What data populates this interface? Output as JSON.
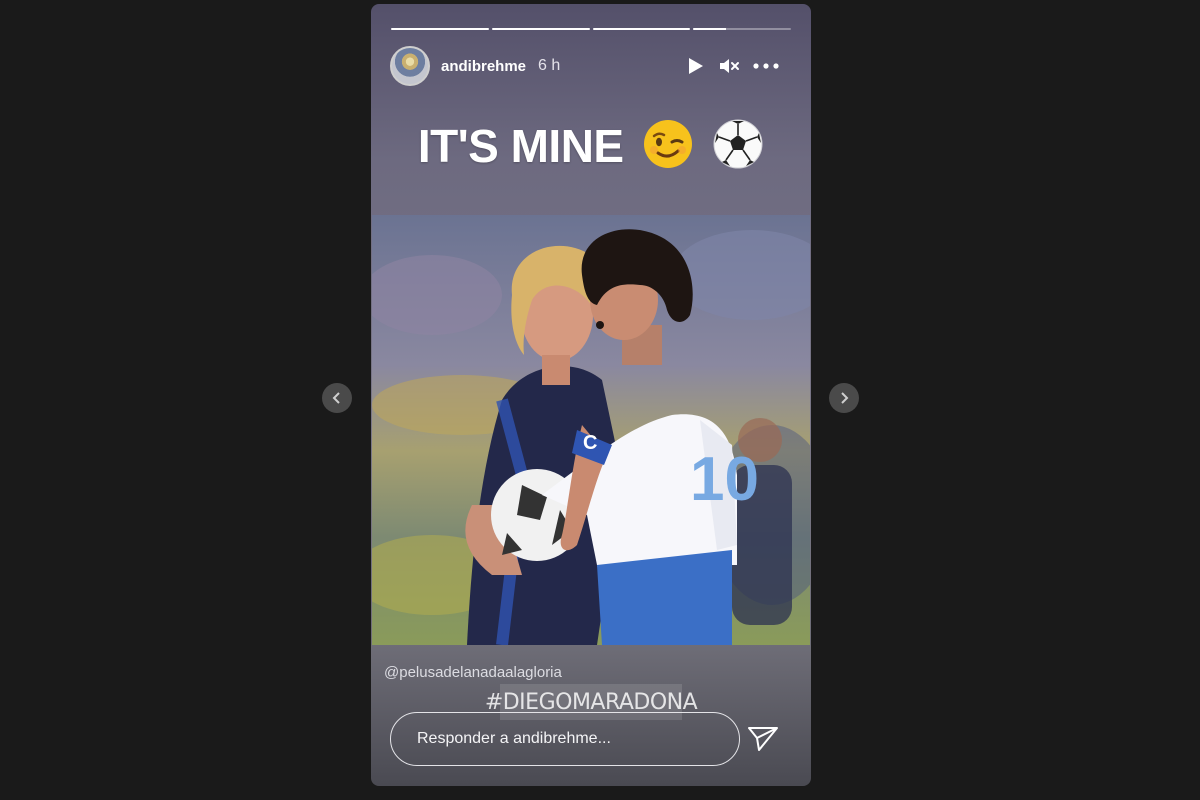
{
  "story": {
    "username": "andibrehme",
    "time_ago": "6 h",
    "progress": [
      1.0,
      1.0,
      1.0,
      0.33
    ],
    "caption_text": "IT'S MINE",
    "caption_emojis": [
      "winking-face-icon",
      "soccer-ball-icon"
    ],
    "mention": "@pelusadelanadaalagloria",
    "hashtag": "#DIEGOMARADONA",
    "photo_jersey_number": "10",
    "photo_armband_letter": "C"
  },
  "controls": {
    "icons": [
      "play-icon",
      "mute-icon",
      "more-options-icon"
    ]
  },
  "reply": {
    "placeholder": "Responder a andibrehme...",
    "value": ""
  },
  "navigation": {
    "icons": [
      "chevron-left-icon",
      "chevron-right-icon"
    ]
  },
  "colors": {
    "page_background": "#1a1a1a",
    "story_background": "#6d6a80",
    "text": "#ffffff",
    "nav_arrow": "#4a4a4a"
  }
}
